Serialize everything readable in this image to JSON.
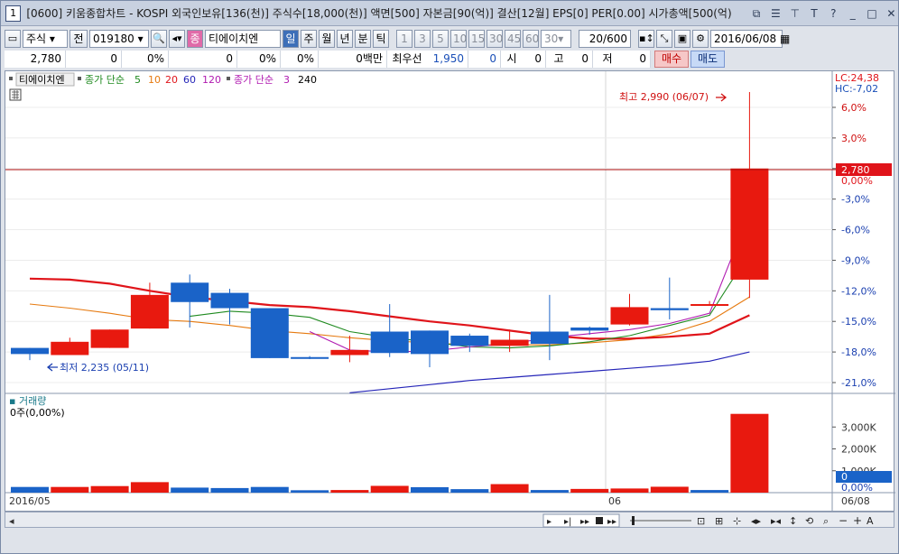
{
  "titlebar": {
    "number": "1",
    "title": "[0600] 키움종합차트 - KOSPI 외국인보유[136(천)] 주식수[18,000(천)] 액면[500] 자본금[90(억)] 결산[12월] EPS[0] PER[0.00] 시가총액[500(억)",
    "buttons": [
      "⧉",
      "☰",
      "⊤",
      "T",
      "?",
      "_",
      "□",
      "✕"
    ]
  },
  "toolbar": {
    "market": "주식",
    "prev_label": "전",
    "code": "019180",
    "name_badge": "종",
    "stock_name": "티에이치엔",
    "periods": [
      "일",
      "주",
      "월",
      "년",
      "분",
      "틱"
    ],
    "selected_period": "일",
    "intervals": [
      "1",
      "3",
      "5",
      "10",
      "15",
      "30",
      "45",
      "60"
    ],
    "interval_value": "30",
    "count": "20/600",
    "date": "2016/06/08"
  },
  "quote": {
    "price": "2,780",
    "change": "0",
    "change_pct": "0%",
    "volume": "0",
    "vol_pct": "0%",
    "vol_pct2": "0%",
    "amount": "0백만",
    "best_label": "최우선",
    "best_price": "1,950",
    "best_qty": "0",
    "open_label": "시",
    "open_val": "0",
    "high_label": "고",
    "high_val": "0",
    "low_label": "저",
    "low_val": "0",
    "buy": "매수",
    "sell": "매도"
  },
  "legend": {
    "stock": "티에이치엔",
    "ma1_label": "종가 단순",
    "ma1_periods": [
      "5",
      "10",
      "20",
      "60",
      "120"
    ],
    "ma2_label": "종가 단순",
    "ma2_periods": [
      "3",
      "240"
    ]
  },
  "price_panel": {
    "lc": "LC:24,38",
    "hc": "HC:-7,02",
    "high_annotation": "최고 2,990 (06/07)",
    "low_annotation": "최저 2,235 (05/11)",
    "current_price_tag": "2,780",
    "current_pct_tag": "0,00%",
    "yticks": [
      "6,0%",
      "3,0%",
      "0,00%",
      "-3,0%",
      "-6,0%",
      "-9,0%",
      "-12,0%",
      "-15,0%",
      "-18,0%",
      "-21,0%"
    ]
  },
  "volume_panel": {
    "title": "거래량",
    "value": "0주(0,00%)",
    "yticks": [
      "3,000K",
      "2,000K",
      "1,000K",
      "0",
      "0,00%"
    ]
  },
  "xaxis": {
    "labels": [
      "2016/05",
      "06",
      "06/08"
    ]
  },
  "colors": {
    "up": "#e8190f",
    "down": "#1a63c8",
    "ma5": "#1f8a1f",
    "ma10": "#e67a10",
    "ma20": "#e0141a",
    "ma60": "#2525b8",
    "ma120": "#b01ab0"
  },
  "chart_data": {
    "type": "candlestick",
    "pct_range": [
      -22.0,
      7.5
    ],
    "candles": [
      {
        "o": -17.6,
        "c": -18.2,
        "h": -17.6,
        "l": -18.8
      },
      {
        "o": -18.3,
        "c": -17.0,
        "h": -16.6,
        "l": -18.3
      },
      {
        "o": -17.6,
        "c": -15.8,
        "h": -15.8,
        "l": -17.6
      },
      {
        "o": -15.7,
        "c": -12.4,
        "h": -11.2,
        "l": -15.7
      },
      {
        "o": -11.2,
        "c": -13.1,
        "h": -10.4,
        "l": -15.6
      },
      {
        "o": -12.2,
        "c": -13.7,
        "h": -11.8,
        "l": -15.3
      },
      {
        "o": -13.7,
        "c": -18.6,
        "h": -13.7,
        "l": -18.6
      },
      {
        "o": -18.5,
        "c": -18.6,
        "h": -18.4,
        "l": -18.7
      },
      {
        "o": -18.3,
        "c": -17.8,
        "h": -16.4,
        "l": -19.0
      },
      {
        "o": -16.0,
        "c": -18.1,
        "h": -13.3,
        "l": -18.5
      },
      {
        "o": -15.9,
        "c": -18.2,
        "h": -15.9,
        "l": -19.5
      },
      {
        "o": -16.4,
        "c": -17.4,
        "h": -16.2,
        "l": -18.0
      },
      {
        "o": -17.4,
        "c": -16.8,
        "h": -15.8,
        "l": -18.0
      },
      {
        "o": -16.0,
        "c": -17.2,
        "h": -12.4,
        "l": -18.8
      },
      {
        "o": -15.6,
        "c": -15.9,
        "h": -15.5,
        "l": -16.3
      },
      {
        "o": -15.3,
        "c": -13.6,
        "h": -12.3,
        "l": -15.4
      },
      {
        "o": -13.7,
        "c": -13.9,
        "h": -10.7,
        "l": -14.8
      },
      {
        "o": -13.4,
        "c": -13.3,
        "h": -13.0,
        "l": -13.4
      },
      {
        "o": -10.9,
        "c": 0.0,
        "h": 7.5,
        "l": -12.7
      }
    ],
    "ma5": [
      null,
      null,
      null,
      null,
      -14.5,
      -14.0,
      -14.2,
      -14.6,
      -16.0,
      -16.6,
      -17.0,
      -17.5,
      -17.6,
      -17.4,
      -17.0,
      -16.4,
      -15.4,
      -14.4,
      -8.3
    ],
    "ma10": [
      -13.3,
      -13.7,
      -14.2,
      -14.8,
      -15.0,
      -15.4,
      -15.9,
      -16.2,
      -16.6,
      -16.9,
      -17.1,
      -17.3,
      -17.3,
      -17.3,
      -17.1,
      -16.8,
      -16.2,
      -15.0,
      -12.6
    ],
    "ma20": [
      -10.8,
      -10.9,
      -11.3,
      -12.0,
      -12.6,
      -13.0,
      -13.4,
      -13.6,
      -14.0,
      -14.5,
      -15.0,
      -15.4,
      -15.9,
      -16.4,
      -16.7,
      -16.7,
      -16.5,
      -16.2,
      -14.4
    ],
    "ma60": [
      null,
      null,
      null,
      null,
      null,
      null,
      null,
      null,
      -22.0,
      -21.6,
      -21.2,
      -20.8,
      -20.5,
      -20.2,
      -19.9,
      -19.6,
      -19.3,
      -18.9,
      -18.0
    ],
    "ma120": [
      null,
      null,
      null,
      null,
      null,
      null,
      null,
      -16.0,
      -17.8,
      -18.0,
      -17.9,
      -17.5,
      -17.2,
      -16.6,
      -16.2,
      -15.8,
      -15.2,
      -14.2,
      -4.3
    ],
    "volume": [
      {
        "v": 260,
        "up": false
      },
      {
        "v": 260,
        "up": true
      },
      {
        "v": 300,
        "up": true
      },
      {
        "v": 480,
        "up": true
      },
      {
        "v": 230,
        "up": false
      },
      {
        "v": 210,
        "up": false
      },
      {
        "v": 260,
        "up": false
      },
      {
        "v": 110,
        "up": false
      },
      {
        "v": 120,
        "up": true
      },
      {
        "v": 310,
        "up": true
      },
      {
        "v": 250,
        "up": false
      },
      {
        "v": 160,
        "up": false
      },
      {
        "v": 390,
        "up": true
      },
      {
        "v": 120,
        "up": false
      },
      {
        "v": 170,
        "up": true
      },
      {
        "v": 190,
        "up": true
      },
      {
        "v": 270,
        "up": true
      },
      {
        "v": 120,
        "up": false
      },
      {
        "v": 3600,
        "up": true
      }
    ],
    "volume_max": 4000
  }
}
